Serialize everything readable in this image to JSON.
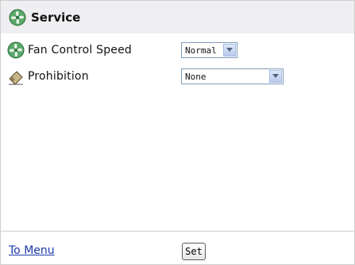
{
  "header": {
    "title": "Service",
    "icon": "fan-icon"
  },
  "rows": [
    {
      "label": "Fan Control Speed",
      "icon": "fan-icon",
      "select_value": "Normal"
    },
    {
      "label": "Prohibition",
      "icon": "eraser-icon",
      "select_value": "None"
    }
  ],
  "footer": {
    "menu_link": "To Menu",
    "set_button": "Set"
  }
}
